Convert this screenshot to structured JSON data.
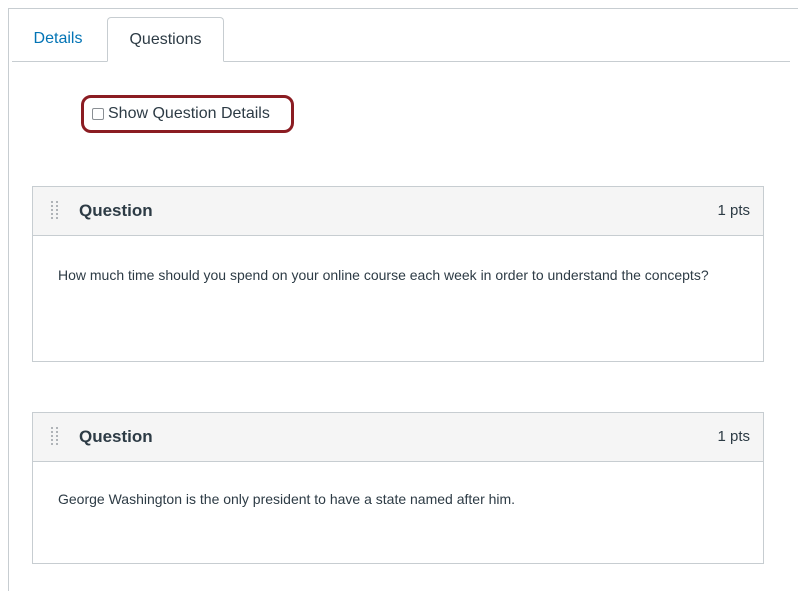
{
  "tabs": {
    "details_label": "Details",
    "questions_label": "Questions"
  },
  "show_details": {
    "label": "Show Question Details",
    "checked": false
  },
  "questions": [
    {
      "title": "Question",
      "points": "1 pts",
      "text": "How much time should you spend on your online course each week in order to understand the concepts?"
    },
    {
      "title": "Question",
      "points": "1 pts",
      "text": "George Washington is the only president to have a state named after him."
    }
  ],
  "colors": {
    "link": "#0374b5",
    "highlight_border": "#8b1c22",
    "header_bg": "#f5f5f5",
    "border": "#c7cdd1"
  },
  "icons": {
    "drag_handle": "drag-handle-icon",
    "checkbox": "checkbox-icon"
  }
}
